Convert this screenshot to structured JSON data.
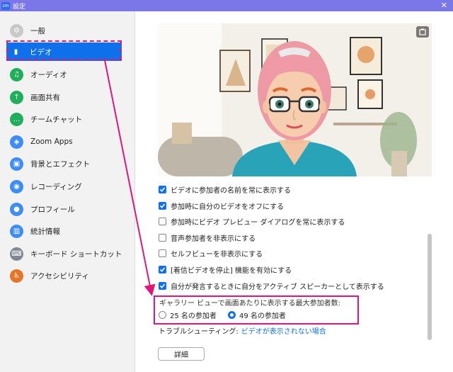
{
  "window": {
    "app_badge": "zm",
    "title": "設定",
    "close": "✕"
  },
  "sidebar": {
    "items": [
      {
        "label": "一般",
        "icon": "gear-icon",
        "color": "#c8c8c8",
        "glyph": "⚙"
      },
      {
        "label": "ビデオ",
        "icon": "video-camera-icon",
        "color": "#0e71eb",
        "glyph": "▮",
        "active": true
      },
      {
        "label": "オーディオ",
        "icon": "headphones-icon",
        "color": "#1fae5a",
        "glyph": "♫"
      },
      {
        "label": "画面共有",
        "icon": "screen-share-icon",
        "color": "#1fae5a",
        "glyph": "↑"
      },
      {
        "label": "チームチャット",
        "icon": "chat-icon",
        "color": "#1fae5a",
        "glyph": "…"
      },
      {
        "label": "Zoom Apps",
        "icon": "apps-icon",
        "color": "#3d8df5",
        "glyph": "◈"
      },
      {
        "label": "背景とエフェクト",
        "icon": "background-icon",
        "color": "#3d8df5",
        "glyph": "▣"
      },
      {
        "label": "レコーディング",
        "icon": "recording-icon",
        "color": "#3d8df5",
        "glyph": "◉"
      },
      {
        "label": "プロフィール",
        "icon": "profile-icon",
        "color": "#3d8df5",
        "glyph": "●"
      },
      {
        "label": "統計情報",
        "icon": "statistics-icon",
        "color": "#3d8df5",
        "glyph": "▥"
      },
      {
        "label": "キーボード ショートカット",
        "icon": "keyboard-icon",
        "color": "#7f8794",
        "glyph": "⌨"
      },
      {
        "label": "アクセシビリティ",
        "icon": "accessibility-icon",
        "color": "#e8742a",
        "glyph": "♿"
      }
    ]
  },
  "preview": {
    "icon": "rotate-camera-icon"
  },
  "options": [
    {
      "label": "ビデオに参加者の名前を常に表示する",
      "checked": true
    },
    {
      "label": "参加時に自分のビデオをオフにする",
      "checked": true
    },
    {
      "label": "参加時にビデオ プレビュー ダイアログを常に表示する",
      "checked": false
    },
    {
      "label": "音声参加者を非表示にする",
      "checked": false
    },
    {
      "label": "セルフビューを非表示にする",
      "checked": false
    },
    {
      "label": "[着信ビデオを停止] 機能を有効にする",
      "checked": true
    },
    {
      "label": "自分が発言するときに自分をアクティブ スピーカーとして表示する",
      "checked": true
    }
  ],
  "gallery": {
    "title": "ギャラリー ビューで画面あたりに表示する最大参加者数:",
    "option_25": "25 名の参加者",
    "option_49": "49 名の参加者",
    "selected": "49"
  },
  "troubleshoot": {
    "label": "トラブルシューティング:",
    "link": "ビデオが表示されない場合"
  },
  "detail_button": "詳細",
  "colors": {
    "accent": "#0e71eb",
    "highlight": "#e3157a",
    "titlebar": "#7b77e8"
  }
}
